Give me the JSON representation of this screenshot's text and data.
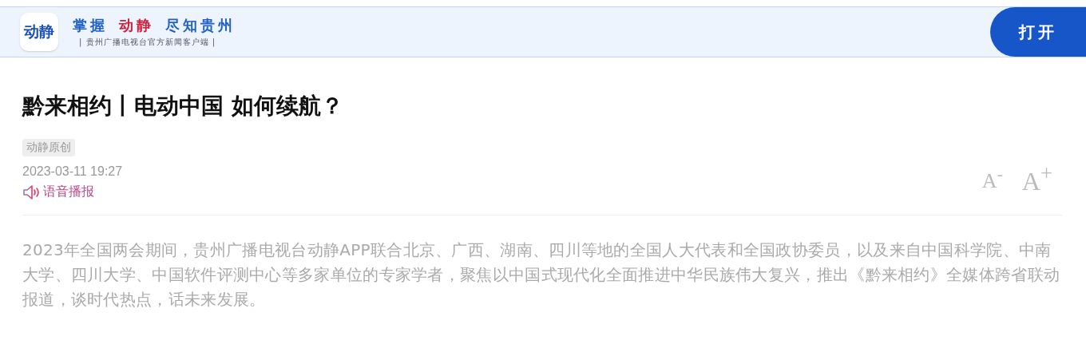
{
  "banner": {
    "logo": "动静",
    "slogan": [
      {
        "text": "掌握",
        "kind": "plain"
      },
      {
        "text": "动静",
        "kind": "brand"
      },
      {
        "text": "尽知贵州",
        "kind": "plain"
      }
    ],
    "subtitle": "| 贵州广播电视台官方新闻客户端 |",
    "open_button": "打开"
  },
  "article": {
    "title": "黔来相约丨电动中国 如何续航？",
    "tag": "动静原创",
    "date": "2023-03-11 19:27",
    "audio": "语音播报",
    "font_buttons": [
      "A$^{-}$",
      "A$^{+}$"
    ],
    "body": "2023年全国两会期间，贵州广播电视台动静APP联合北京、广西、湖南、四川等地的全国人大代表和全国政协委员，以及来自中国科学院、中南大学、四川大学、中国软件评测中心等多家单位的专家学者，聚焦以中国式现代化全面推进中华民族伟大复兴，推出《黔来相约》全媒体跨省联动报道，谈时代热点，话未来发展。"
  }
}
